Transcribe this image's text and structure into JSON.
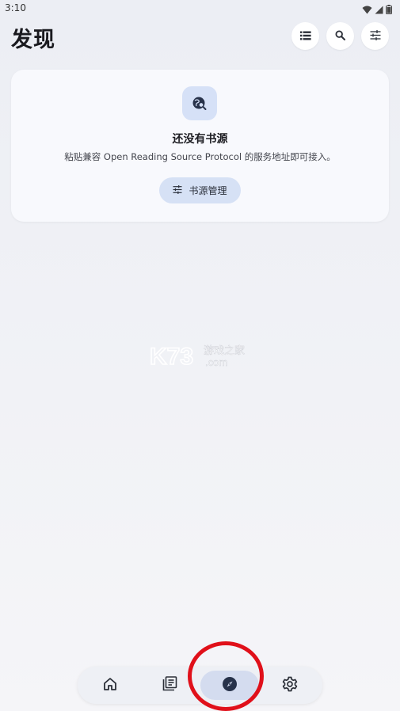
{
  "status_bar": {
    "time": "3:10",
    "icons": [
      "wifi-icon",
      "signal-icon",
      "battery-icon"
    ]
  },
  "header": {
    "title": "发现",
    "actions": [
      "list-icon",
      "search-icon",
      "tune-icon"
    ]
  },
  "empty_card": {
    "icon": "source-search-icon",
    "title": "还没有书源",
    "description": "粘贴兼容 Open Reading Source Protocol 的服务地址即可接入。",
    "button_label": "书源管理",
    "button_icon": "tune-icon"
  },
  "watermark": {
    "brand": "K73",
    "cn": "游戏之家",
    "domain": ".com"
  },
  "bottom_nav": {
    "items": [
      "home-icon",
      "library-icon",
      "explore-icon",
      "settings-icon"
    ],
    "active": "explore-icon"
  },
  "colors": {
    "accent": "#d6e1f5",
    "highlight_ring": "#e0101a"
  }
}
